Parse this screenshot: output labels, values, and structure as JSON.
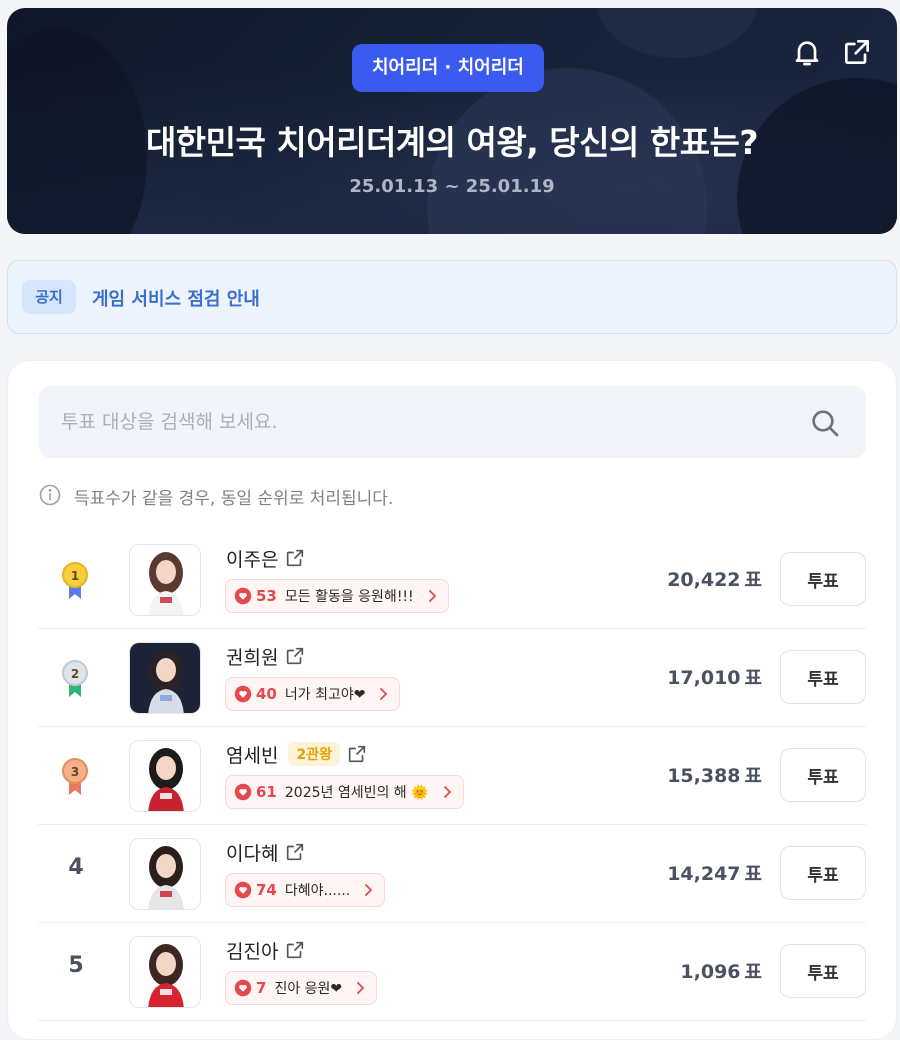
{
  "header": {
    "category": "치어리더 · 치어리더",
    "title": "대한민국 치어리더계의 여왕, 당신의 한표는?",
    "period": "25.01.13 ~ 25.01.19",
    "icons": [
      "bell-icon",
      "share-icon"
    ]
  },
  "notice": {
    "tag": "공지",
    "text": "게임 서비스 점검 안내"
  },
  "search": {
    "placeholder": "투표 대상을 검색해 보세요."
  },
  "info_text": "득표수가 같을 경우, 동일 순위로 처리됩니다.",
  "vote_unit": "표",
  "vote_button_label": "투표",
  "colors": {
    "accent": "#3b5bf0",
    "gold": "#f2c230",
    "silver": "#c7ccd6",
    "bronze": "#ec9a65",
    "heart": "#e5484d"
  },
  "candidates": [
    {
      "rank": "1",
      "medal": "gold",
      "name": "이주은",
      "badge": "",
      "cheer_count": "53",
      "cheer_message": "모든 활동을 응원해!!!",
      "votes": "20,422"
    },
    {
      "rank": "2",
      "medal": "silver",
      "name": "권희원",
      "badge": "",
      "cheer_count": "40",
      "cheer_message": "너가 최고야❤",
      "votes": "17,010"
    },
    {
      "rank": "3",
      "medal": "bronze",
      "name": "염세빈",
      "badge": "2관왕",
      "cheer_count": "61",
      "cheer_message": "2025년 염세빈의 해 🌞",
      "votes": "15,388"
    },
    {
      "rank": "4",
      "medal": "",
      "name": "이다혜",
      "badge": "",
      "cheer_count": "74",
      "cheer_message": "다혜야......",
      "votes": "14,247"
    },
    {
      "rank": "5",
      "medal": "",
      "name": "김진아",
      "badge": "",
      "cheer_count": "7",
      "cheer_message": "진아 응원❤",
      "votes": "1,096"
    }
  ]
}
